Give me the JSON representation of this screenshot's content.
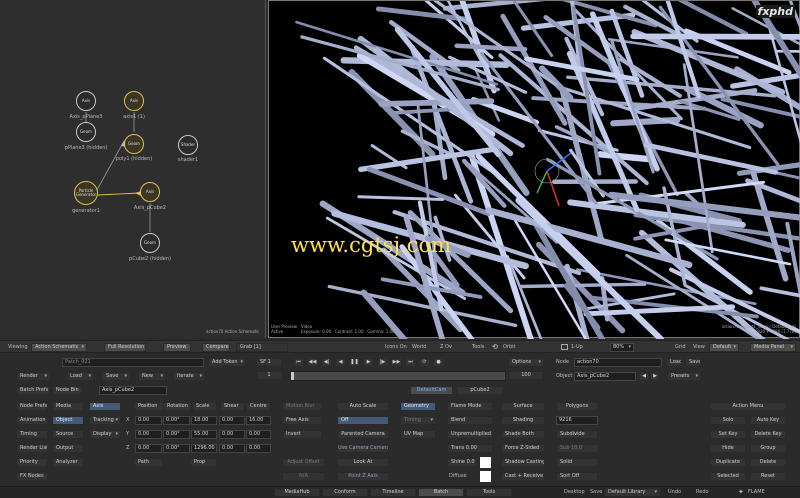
{
  "brand": "fxphd",
  "watermark": "www.cgtsj.com",
  "schematic": {
    "title": "action70 Action Schematic",
    "nodes": [
      {
        "text": "Axis",
        "label": "Axis_pPlane3"
      },
      {
        "text": "Geom",
        "label": "pPlane3 (hidden)"
      },
      {
        "text": "Axis",
        "label": "axis1 (1)"
      },
      {
        "text": "Geom",
        "label": "poly1 (hidden)"
      },
      {
        "text": "Shader",
        "label": "shader1"
      },
      {
        "text": "Particle Generator",
        "label": "generator1"
      },
      {
        "text": "Axis",
        "label": "Axis_pCube2"
      },
      {
        "text": "Geom",
        "label": "pCube2 (hidden)"
      }
    ]
  },
  "viewport": {
    "info_left": [
      "User Preview",
      "Active"
    ],
    "info_mid": [
      "Video",
      "Exposure: 0.00",
      "Contrast: 1.00",
      "Gamma: 1.00"
    ],
    "info_right": [
      "action70 output1_Comp: DefaultCam",
      "1920 x 1080 (1.778)"
    ]
  },
  "viewbar": {
    "viewing": "Viewing",
    "mode": "Action Schematic",
    "resolution": "Full Resolution",
    "preview": "Preview",
    "compare": "Compare",
    "grab": "Grab [1]",
    "icons_on": "Icons On",
    "world": "World",
    "zoom": "Z Ov",
    "tools": "Tools",
    "orbit": "Orbit",
    "layout": "1-Up",
    "percent": "80%",
    "grid": "Grid",
    "view": "View",
    "view_mode": "Default",
    "media_panel": "Media Panel"
  },
  "toolbar1": {
    "search": "Patch_021",
    "add_token": "Add Token",
    "frame": "SF 1",
    "cur_frame": "1",
    "end_frame": "100",
    "options": "Options",
    "node_label": "Node",
    "node_name": "action70",
    "load": "Load",
    "save": "Save"
  },
  "toolbar2": {
    "render": "Render",
    "load": "Load",
    "save": "Save",
    "new": "New",
    "iterate": "Iterate",
    "object_label": "Object",
    "object_name": "Axis_pCube2",
    "presets": "Presets"
  },
  "toolbar3": {
    "batch_prefs": "Batch Prefs",
    "node_bin": "Node Bin",
    "object_field": "Axis_pCube2",
    "tab_default": "DefaultCam",
    "tab_pcube": "pCube2"
  },
  "left_col": [
    "Node Prefs",
    "Animation",
    "Timing",
    "Render List",
    "Priority",
    "FX Nodes"
  ],
  "col2": [
    "Media",
    "Object",
    "Source",
    "Output",
    "Analyzer"
  ],
  "col3": [
    "Axis",
    "Tracking",
    "Display"
  ],
  "axis_headers": [
    "Position",
    "Rotation",
    "Scale",
    "Shear",
    "Centre"
  ],
  "axis_rows": [
    {
      "axis": "X",
      "values": [
        "0.00",
        "0.00°",
        "18.00",
        "0.00",
        "16.00"
      ]
    },
    {
      "axis": "Y",
      "values": [
        "0.00",
        "0.00°",
        "55.00",
        "0.00",
        "0.00"
      ]
    },
    {
      "axis": "Z",
      "values": [
        "0.00",
        "0.00°",
        "1296.00",
        "0.00",
        "0.00"
      ]
    }
  ],
  "path": "Path",
  "prop": "Prop",
  "motion_blur": "Motion Blur",
  "free_axis": "Free Axis",
  "invert": "Invert",
  "adjust_offset": "Adjust Offset",
  "na": "N/A",
  "auto_scale": "Auto Scale",
  "off": "Off",
  "parented_camera": "Parented Camera",
  "use_camera": "Use Camera Camera",
  "look_at": "Look At",
  "point_z": "Point Z Axis",
  "geom_col": [
    "Geometry",
    "Timing",
    "UV Map"
  ],
  "flame_col": [
    "Flame Mode",
    "Blend",
    "Unpremultiplied",
    "Trans 0.00",
    "Shine 0.0",
    "Diffuse"
  ],
  "surface_col": [
    "Surface",
    "Shading",
    "Shade Both",
    "Force Z-Sided",
    "Shadow Casting",
    "Cast + Receive"
  ],
  "poly_col": [
    "Polygons",
    "9216",
    "Subdivide",
    "Sub 10.0",
    "Solid",
    "Sort Off"
  ],
  "action_menu": {
    "title": "Action Menu",
    "items": [
      "Solo",
      "Auto Key",
      "Set Key",
      "Delete Key",
      "Hide",
      "Group",
      "Duplicate",
      "Delete",
      "Selected",
      "Reset"
    ]
  },
  "bottom_tabs": [
    "MediaHub",
    "Conform",
    "Timeline",
    "Batch",
    "Tools"
  ],
  "bottom_right": {
    "desktop": "Desktop",
    "save": "Save",
    "library": "Default Library",
    "undo": "Undo",
    "redo": "Redo",
    "flame": "FLAME"
  },
  "colors": {
    "accent_yellow": "#e0c14a",
    "selected_blue": "#465a76",
    "watermark": "#ffe14a"
  }
}
